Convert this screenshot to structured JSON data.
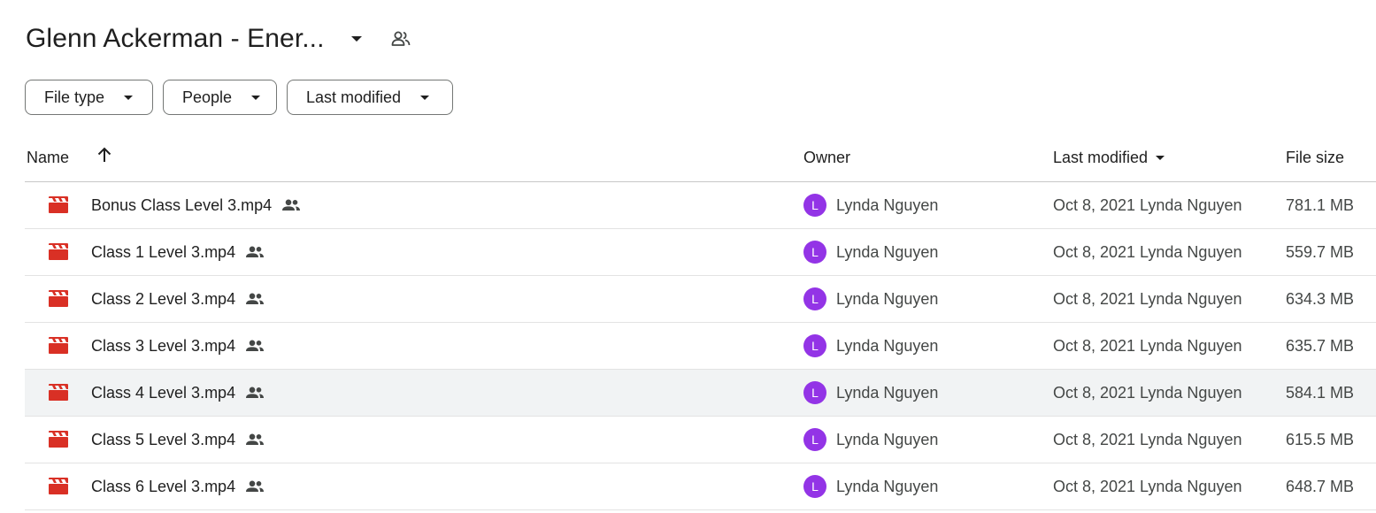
{
  "folder": {
    "title": "Glenn Ackerman - Ener..."
  },
  "filters": [
    {
      "label": "File type"
    },
    {
      "label": "People"
    },
    {
      "label": "Last modified"
    }
  ],
  "columns": {
    "name": "Name",
    "owner": "Owner",
    "last_modified": "Last modified",
    "file_size": "File size"
  },
  "colors": {
    "video_icon": "#d93025",
    "avatar": "#9334e6",
    "row_hover": "#f1f3f4"
  },
  "icons": {
    "title_caret": "caret-down-icon",
    "title_shared": "shared-people-icon",
    "sort": "arrow-up-icon",
    "file": "video-file-icon",
    "shared": "shared-people-icon"
  },
  "rows": [
    {
      "name": "Bonus Class Level 3.mp4",
      "owner_initial": "L",
      "owner": "Lynda Nguyen",
      "modified": "Oct 8, 2021 Lynda Nguyen",
      "size": "781.1 MB"
    },
    {
      "name": "Class 1 Level 3.mp4",
      "owner_initial": "L",
      "owner": "Lynda Nguyen",
      "modified": "Oct 8, 2021 Lynda Nguyen",
      "size": "559.7 MB"
    },
    {
      "name": "Class 2 Level 3.mp4",
      "owner_initial": "L",
      "owner": "Lynda Nguyen",
      "modified": "Oct 8, 2021 Lynda Nguyen",
      "size": "634.3 MB"
    },
    {
      "name": "Class 3 Level 3.mp4",
      "owner_initial": "L",
      "owner": "Lynda Nguyen",
      "modified": "Oct 8, 2021 Lynda Nguyen",
      "size": "635.7 MB"
    },
    {
      "name": "Class 4 Level 3.mp4",
      "owner_initial": "L",
      "owner": "Lynda Nguyen",
      "modified": "Oct 8, 2021 Lynda Nguyen",
      "size": "584.1 MB"
    },
    {
      "name": "Class 5 Level 3.mp4",
      "owner_initial": "L",
      "owner": "Lynda Nguyen",
      "modified": "Oct 8, 2021 Lynda Nguyen",
      "size": "615.5 MB"
    },
    {
      "name": "Class 6 Level 3.mp4",
      "owner_initial": "L",
      "owner": "Lynda Nguyen",
      "modified": "Oct 8, 2021 Lynda Nguyen",
      "size": "648.7 MB"
    }
  ]
}
